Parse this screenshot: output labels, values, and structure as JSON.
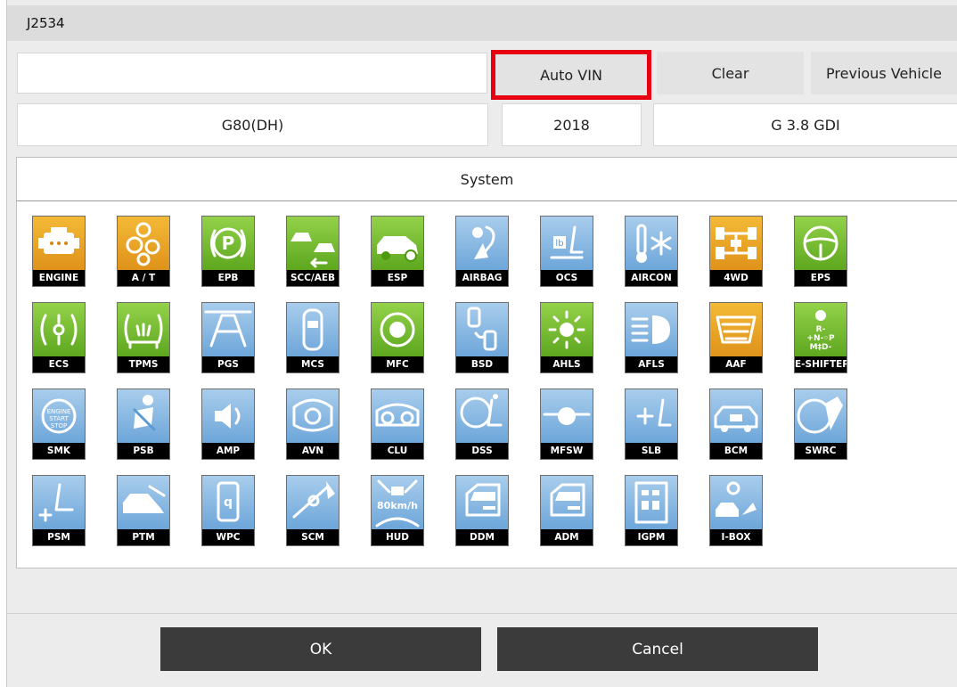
{
  "window": {
    "title": "J2534"
  },
  "vin": {
    "value": ""
  },
  "buttons": {
    "auto_vin": "Auto VIN",
    "clear": "Clear",
    "previous_vehicle": "Previous Vehicle",
    "ok": "OK",
    "cancel": "Cancel"
  },
  "vehicle": {
    "model": "G80(DH)",
    "year": "2018",
    "engine": "G 3.8 GDI"
  },
  "system": {
    "header": "System",
    "tiles": [
      {
        "label": "ENGINE",
        "color": "orange",
        "icon": "engine-icon"
      },
      {
        "label": "A / T",
        "color": "orange",
        "icon": "gears-icon"
      },
      {
        "label": "EPB",
        "color": "green",
        "icon": "parking-brake-icon"
      },
      {
        "label": "SCC/AEB",
        "color": "green",
        "icon": "collision-icon"
      },
      {
        "label": "ESP",
        "color": "green",
        "icon": "car-stability-icon"
      },
      {
        "label": "AIRBAG",
        "color": "blue",
        "icon": "airbag-icon"
      },
      {
        "label": "OCS",
        "color": "blue",
        "icon": "seat-weight-icon"
      },
      {
        "label": "AIRCON",
        "color": "blue",
        "icon": "aircon-icon"
      },
      {
        "label": "4WD",
        "color": "orange",
        "icon": "drivetrain-icon"
      },
      {
        "label": "EPS",
        "color": "green",
        "icon": "steering-wheel-icon"
      },
      {
        "label": "ECS",
        "color": "green",
        "icon": "suspension-icon"
      },
      {
        "label": "TPMS",
        "color": "green",
        "icon": "tire-pressure-icon"
      },
      {
        "label": "PGS",
        "color": "blue",
        "icon": "parking-guide-icon"
      },
      {
        "label": "MCS",
        "color": "blue",
        "icon": "car-top-icon"
      },
      {
        "label": "MFC",
        "color": "green",
        "icon": "camera-icon"
      },
      {
        "label": "BSD",
        "color": "blue",
        "icon": "blind-spot-icon"
      },
      {
        "label": "AHLS",
        "color": "green",
        "icon": "headlamp-level-icon"
      },
      {
        "label": "AFLS",
        "color": "blue",
        "icon": "headlamp-icon"
      },
      {
        "label": "AAF",
        "color": "orange",
        "icon": "grille-icon"
      },
      {
        "label": "E-SHIFTER",
        "color": "green",
        "icon": "shifter-icon"
      },
      {
        "label": "SMK",
        "color": "blue",
        "icon": "start-stop-icon"
      },
      {
        "label": "PSB",
        "color": "blue",
        "icon": "seatbelt-icon"
      },
      {
        "label": "AMP",
        "color": "blue",
        "icon": "speaker-icon"
      },
      {
        "label": "AVN",
        "color": "blue",
        "icon": "dashboard-icon"
      },
      {
        "label": "CLU",
        "color": "blue",
        "icon": "cluster-icon"
      },
      {
        "label": "DSS",
        "color": "blue",
        "icon": "driver-seat-icon"
      },
      {
        "label": "MFSW",
        "color": "blue",
        "icon": "switch-icon"
      },
      {
        "label": "SLB",
        "color": "blue",
        "icon": "lumbar-icon"
      },
      {
        "label": "BCM",
        "color": "blue",
        "icon": "body-control-icon"
      },
      {
        "label": "SWRC",
        "color": "blue",
        "icon": "remote-control-icon"
      },
      {
        "label": "PSM",
        "color": "blue",
        "icon": "power-seat-icon"
      },
      {
        "label": "PTM",
        "color": "blue",
        "icon": "tailgate-icon"
      },
      {
        "label": "WPC",
        "color": "blue",
        "icon": "wireless-charger-icon"
      },
      {
        "label": "SCM",
        "color": "blue",
        "icon": "column-icon"
      },
      {
        "label": "HUD",
        "color": "blue",
        "icon": "head-up-display-icon",
        "text": "80km/h"
      },
      {
        "label": "DDM",
        "color": "blue",
        "icon": "driver-door-icon"
      },
      {
        "label": "ADM",
        "color": "blue",
        "icon": "assist-door-icon"
      },
      {
        "label": "IGPM",
        "color": "blue",
        "icon": "fuse-box-icon"
      },
      {
        "label": "I-BOX",
        "color": "blue",
        "icon": "bluetooth-car-icon"
      }
    ]
  }
}
